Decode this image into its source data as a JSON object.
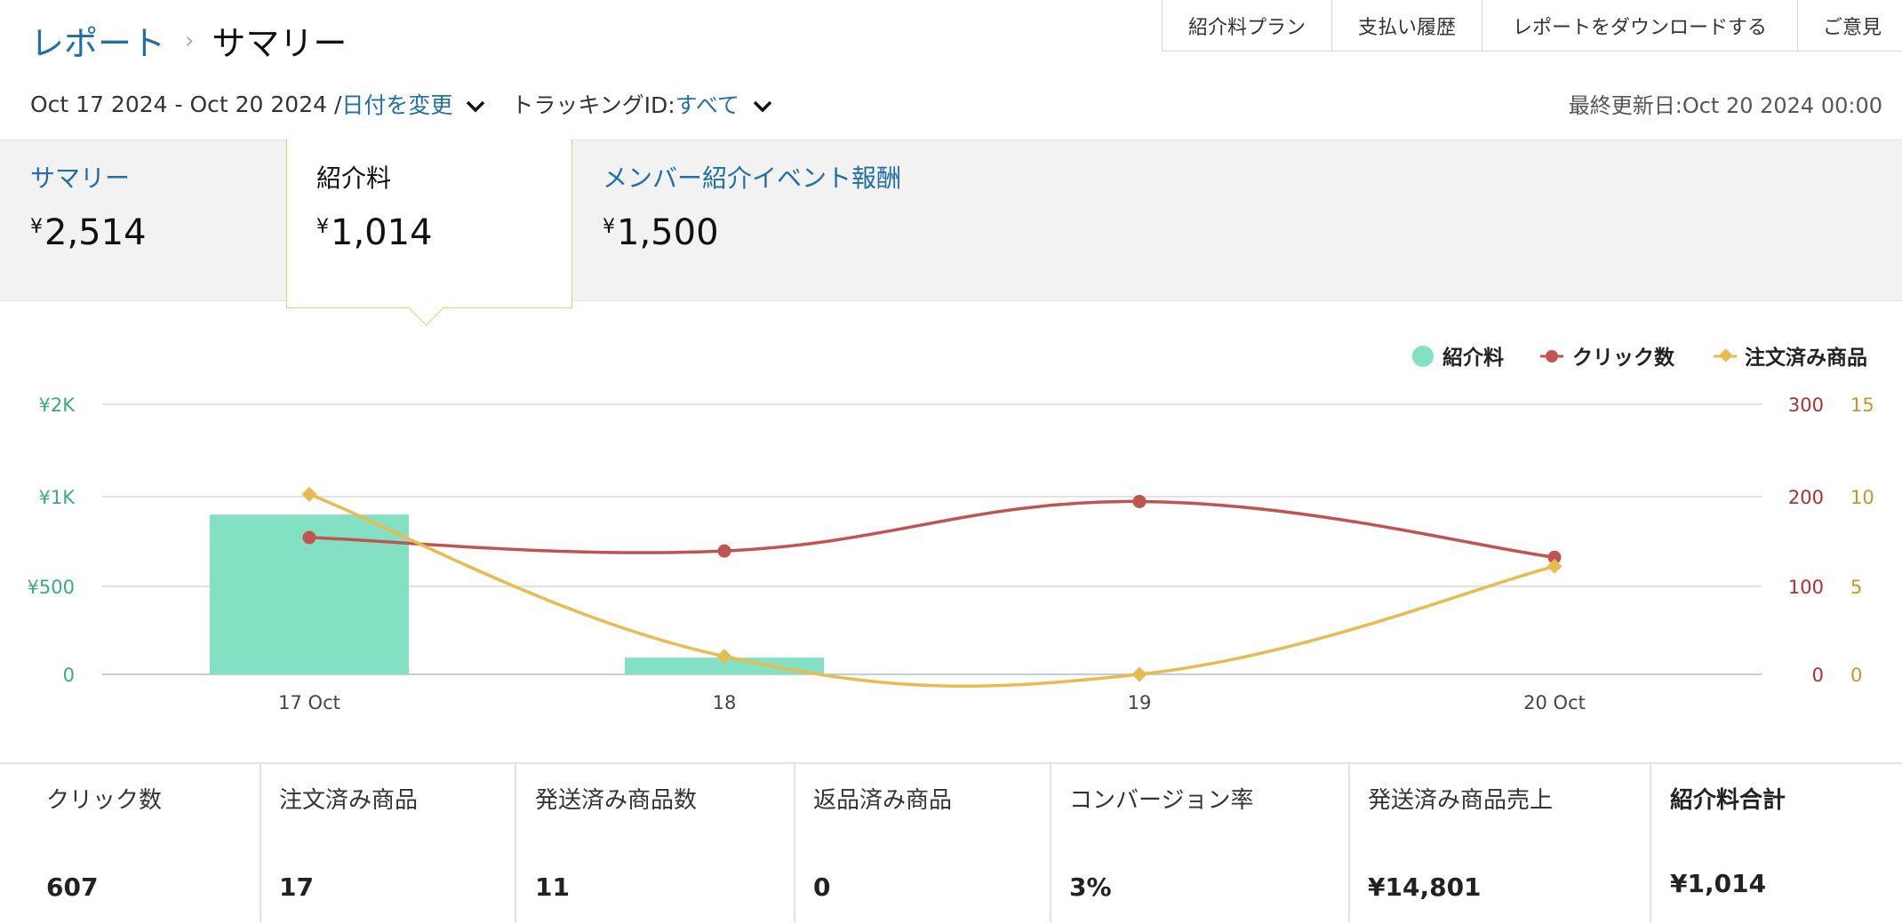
{
  "breadcrumb": {
    "parent": "レポート",
    "separator": "›",
    "current": "サマリー"
  },
  "top_links": [
    "紹介料プラン",
    "支払い履歴",
    "レポートをダウンロードする",
    "ご意見"
  ],
  "date_row": {
    "range": "Oct 17 2024 - Oct 20 2024 /",
    "change_date": "日付を変更",
    "tracking_label": "トラッキングID:",
    "tracking_value": "すべて"
  },
  "last_updated": "最終更新日:Oct 20 2024 00:00",
  "tiles": [
    {
      "label": "サマリー",
      "currency": "¥",
      "value": "2,514"
    },
    {
      "label": "紹介料",
      "currency": "¥",
      "value": "1,014"
    },
    {
      "label": "メンバー紹介イベント報酬",
      "currency": "¥",
      "value": "1,500"
    }
  ],
  "chart_data": {
    "type": "bar+line",
    "legend_position": "top-right",
    "grid": true,
    "categories": [
      "17 Oct",
      "18",
      "19",
      "20 Oct"
    ],
    "series": [
      {
        "name": "紹介料",
        "type": "bar",
        "axis": "left",
        "color": "#84e0c3",
        "values": [
          900,
          95,
          0,
          0
        ]
      },
      {
        "name": "クリック数",
        "type": "line",
        "axis": "right1",
        "color": "#c05450",
        "values": [
          152,
          137,
          192,
          130
        ]
      },
      {
        "name": "注文済み商品",
        "type": "line",
        "axis": "right2",
        "color": "#e8bb50",
        "values": [
          10,
          1,
          0,
          6
        ]
      }
    ],
    "axes": {
      "left": {
        "ticks": [
          "0",
          "¥500",
          "¥1K",
          "¥2K"
        ],
        "color": "#3aaa80"
      },
      "right1": {
        "ylim": [
          0,
          300
        ],
        "ticks": [
          "0",
          "100",
          "200",
          "300"
        ],
        "color": "#b03030"
      },
      "right2": {
        "ylim": [
          0,
          15
        ],
        "ticks": [
          "0",
          "5",
          "10",
          "15"
        ],
        "color": "#c69626"
      }
    }
  },
  "stats": [
    {
      "label": "クリック数",
      "value": "607"
    },
    {
      "label": "注文済み商品",
      "value": "17"
    },
    {
      "label": "発送済み商品数",
      "value": "11"
    },
    {
      "label": "返品済み商品",
      "value": "0"
    },
    {
      "label": "コンバージョン率",
      "value": "3%"
    },
    {
      "label": "発送済み商品売上",
      "value": "¥14,801"
    },
    {
      "label": "紹介料合計",
      "value": "¥1,014"
    }
  ]
}
